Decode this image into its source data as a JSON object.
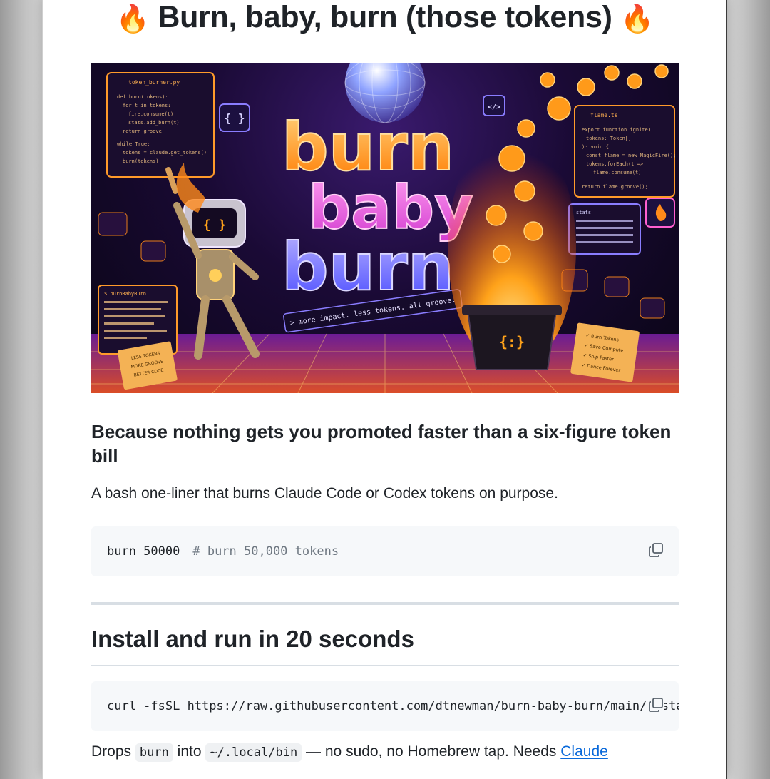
{
  "header": {
    "title": "Burn, baby, burn (those tokens)",
    "emoji_left": "🔥",
    "emoji_right": "🔥"
  },
  "hero": {
    "word1": "burn",
    "word2": "baby",
    "word3": "burn",
    "tagline": "> more impact. less tokens. all groove.",
    "robot_face": "{ }",
    "cauldron_face": "{:}",
    "chip_braces": "{ }",
    "chip_tag": "</>",
    "left_sign": "LESS TOKENS MORE GROOVE BETTER CODE",
    "right_sign": "✓ Burn Tokens ✓ Save Compute ✓ Ship Faster ✓ Dance Forever",
    "code_panel_title": "token_burner.py",
    "right_panel_title": "flame.ts",
    "stats_title": "stats",
    "terminal_title": "$ burnBabyBurn"
  },
  "section1": {
    "heading": "Because nothing gets you promoted faster than a six-figure token bill",
    "lead": "A bash one-liner that burns Claude Code or Codex tokens on purpose."
  },
  "code1": {
    "command": "burn 50000",
    "comment": "# burn 50,000 tokens"
  },
  "section2": {
    "heading": "Install and run in 20 seconds"
  },
  "code2": {
    "command": "curl -fsSL https://raw.githubusercontent.com/dtnewman/burn-baby-burn/main/install.sh | bash"
  },
  "install_note": {
    "before": "Drops",
    "code_a": "burn",
    "middle": "into",
    "code_b": "~/.local/bin",
    "after": "— no sudo, no Homebrew tap. Needs",
    "link": "Claude"
  },
  "colors": {
    "accent_orange": "#ff8a1a",
    "accent_pink": "#ff4fd8",
    "link": "#0969da",
    "code_bg": "#f6f8fa"
  },
  "icons": {
    "copy": "copy-icon"
  }
}
